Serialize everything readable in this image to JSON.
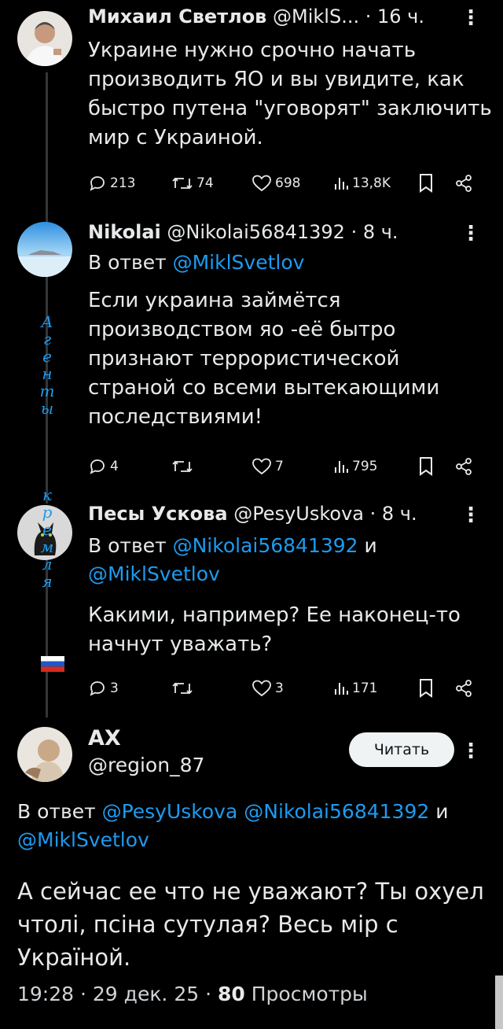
{
  "tweets": [
    {
      "name": "Михаил Светлов",
      "handle": "@MiklS...",
      "time": "· 16 ч.",
      "text": "Украине нужно срочно начать производить ЯО и вы увидите, как быстро путена \"уговорят\" заключить мир с Украиной.",
      "replies": "213",
      "reposts": "74",
      "likes": "698",
      "views": "13,8K"
    },
    {
      "name": "Nikolai",
      "handle": "@Nikolai56841392",
      "time": "· 8 ч.",
      "reply_prefix": "В ответ",
      "reply_mentions": "@MiklSvetlov",
      "text": "Если украина займётся производством яо -её бытро признают террористической страной со всеми вытекающими последствиями!",
      "replies": "4",
      "reposts": "",
      "likes": "7",
      "views": "795"
    },
    {
      "name": "Песы Ускова",
      "handle": "@PesyUskova",
      "time": "· 8 ч.",
      "reply_prefix": "В ответ",
      "reply_mention_1": "@Nikolai56841392",
      "reply_and": "и",
      "reply_mention_2": "@MiklSvetlov",
      "text": "Какими, например? Ее наконец-то начнут уважать?",
      "replies": "3",
      "reposts": "",
      "likes": "3",
      "views": "171"
    }
  ],
  "overlay_vertical_text": [
    "А",
    "г",
    "е",
    "н",
    "т",
    "ы",
    "",
    "к",
    "р",
    "е",
    "м",
    "л",
    "я"
  ],
  "main_tweet": {
    "name": "АХ",
    "handle": "@region_87",
    "follow_label": "Читать",
    "reply_prefix": "В ответ",
    "reply_mention_1": "@PesyUskova",
    "reply_mention_2": "@Nikolai56841392",
    "reply_and": "и",
    "reply_mention_3": "@MiklSvetlov",
    "text": "А сейчас ее что не уважают?  Ты охуел чтолі, псіна сутулая? Весь мір с Україной.",
    "time": "19:28",
    "date": "29 дек. 25",
    "views_count": "80",
    "views_label": "Просмотры"
  },
  "colors": {
    "accent": "#1d9bf0",
    "background": "#000000",
    "text": "#e7e9ea"
  }
}
